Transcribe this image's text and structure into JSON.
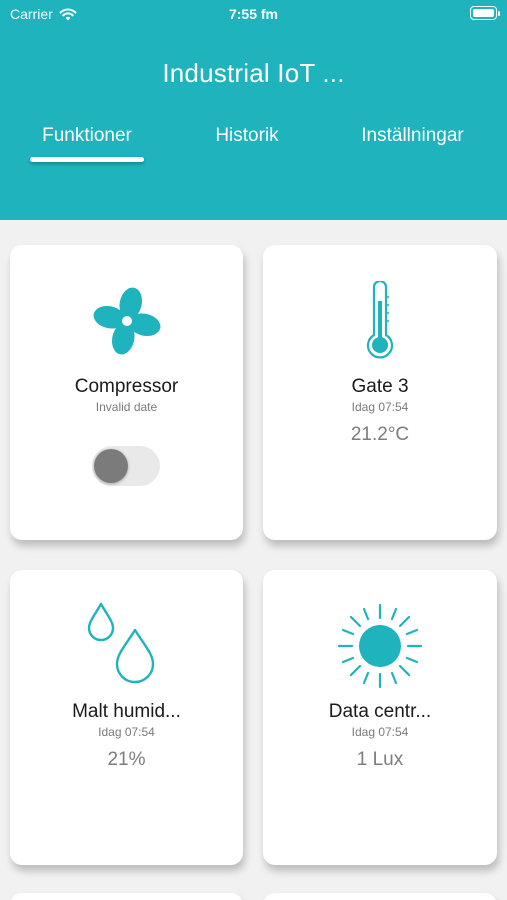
{
  "status_bar": {
    "carrier": "Carrier",
    "time": "7:55 fm"
  },
  "header": {
    "title": "Industrial IoT ..."
  },
  "tabs": [
    {
      "label": "Funktioner",
      "active": true
    },
    {
      "label": "Historik",
      "active": false
    },
    {
      "label": "Inställningar",
      "active": false
    }
  ],
  "colors": {
    "accent": "#1eb3bd",
    "background": "#f1f1f1",
    "card": "#ffffff"
  },
  "cards": [
    {
      "icon": "fan-icon",
      "name": "Compressor",
      "timestamp": "Invalid date",
      "switch_on": false
    },
    {
      "icon": "thermometer-icon",
      "name": "Gate 3",
      "timestamp": "Idag 07:54",
      "value": "21.2°C"
    },
    {
      "icon": "water-drops-icon",
      "name": "Malt humid...",
      "timestamp": "Idag 07:54",
      "value": "21%"
    },
    {
      "icon": "sun-icon",
      "name": "Data centr...",
      "timestamp": "Idag 07:54",
      "value": "1 Lux"
    }
  ]
}
